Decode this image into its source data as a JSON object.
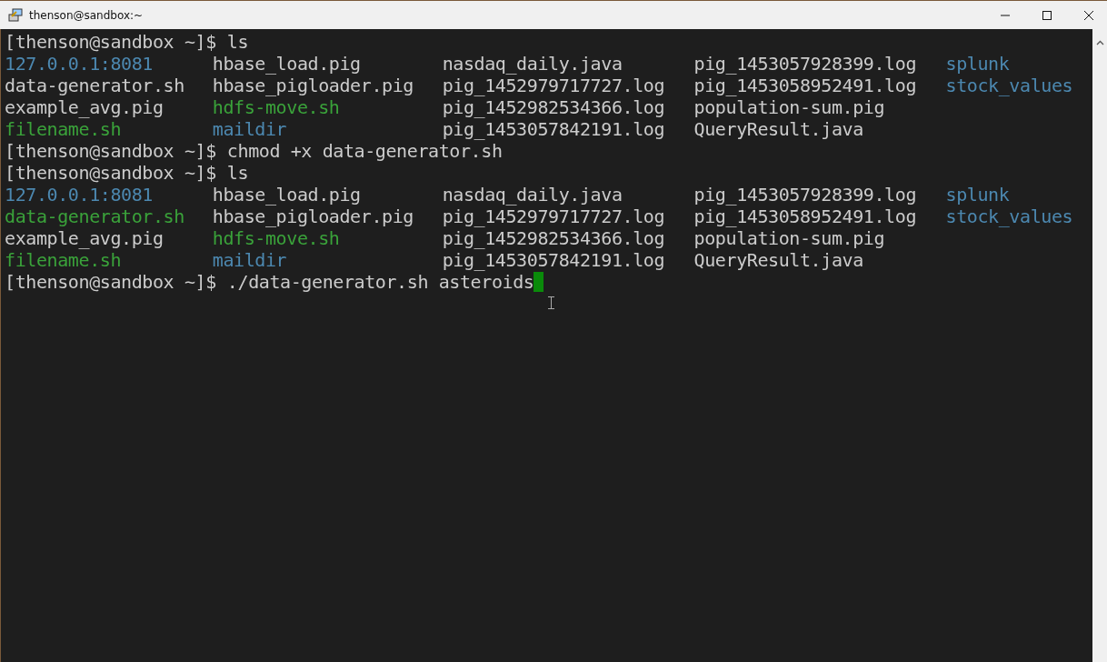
{
  "window": {
    "title": "thenson@sandbox:~"
  },
  "terminal": {
    "lines": [
      {
        "kind": "command",
        "prompt": "[thenson@sandbox ~]$",
        "command": "ls",
        "cursor": false
      },
      {
        "kind": "listing",
        "entries": [
          {
            "name": "127.0.0.1:8081",
            "kind": "dir"
          },
          {
            "name": "hbase_load.pig",
            "kind": "file"
          },
          {
            "name": "nasdaq_daily.java",
            "kind": "file"
          },
          {
            "name": "pig_1453057928399.log",
            "kind": "file"
          },
          {
            "name": "splunk",
            "kind": "dir"
          }
        ]
      },
      {
        "kind": "listing",
        "entries": [
          {
            "name": "data-generator.sh",
            "kind": "file"
          },
          {
            "name": "hbase_pigloader.pig",
            "kind": "file"
          },
          {
            "name": "pig_1452979717727.log",
            "kind": "file"
          },
          {
            "name": "pig_1453058952491.log",
            "kind": "file"
          },
          {
            "name": "stock_values",
            "kind": "dir"
          }
        ]
      },
      {
        "kind": "listing",
        "entries": [
          {
            "name": "example_avg.pig",
            "kind": "file"
          },
          {
            "name": "hdfs-move.sh",
            "kind": "exec"
          },
          {
            "name": "pig_1452982534366.log",
            "kind": "file"
          },
          {
            "name": "population-sum.pig",
            "kind": "file"
          }
        ]
      },
      {
        "kind": "listing",
        "entries": [
          {
            "name": "filename.sh",
            "kind": "exec"
          },
          {
            "name": "maildir",
            "kind": "dir"
          },
          {
            "name": "pig_1453057842191.log",
            "kind": "file"
          },
          {
            "name": "QueryResult.java",
            "kind": "file"
          }
        ]
      },
      {
        "kind": "command",
        "prompt": "[thenson@sandbox ~]$",
        "command": "chmod +x data-generator.sh",
        "cursor": false
      },
      {
        "kind": "command",
        "prompt": "[thenson@sandbox ~]$",
        "command": "ls",
        "cursor": false
      },
      {
        "kind": "listing",
        "entries": [
          {
            "name": "127.0.0.1:8081",
            "kind": "dir"
          },
          {
            "name": "hbase_load.pig",
            "kind": "file"
          },
          {
            "name": "nasdaq_daily.java",
            "kind": "file"
          },
          {
            "name": "pig_1453057928399.log",
            "kind": "file"
          },
          {
            "name": "splunk",
            "kind": "dir"
          }
        ]
      },
      {
        "kind": "listing",
        "entries": [
          {
            "name": "data-generator.sh",
            "kind": "exec"
          },
          {
            "name": "hbase_pigloader.pig",
            "kind": "file"
          },
          {
            "name": "pig_1452979717727.log",
            "kind": "file"
          },
          {
            "name": "pig_1453058952491.log",
            "kind": "file"
          },
          {
            "name": "stock_values",
            "kind": "dir"
          }
        ]
      },
      {
        "kind": "listing",
        "entries": [
          {
            "name": "example_avg.pig",
            "kind": "file"
          },
          {
            "name": "hdfs-move.sh",
            "kind": "exec"
          },
          {
            "name": "pig_1452982534366.log",
            "kind": "file"
          },
          {
            "name": "population-sum.pig",
            "kind": "file"
          }
        ]
      },
      {
        "kind": "listing",
        "entries": [
          {
            "name": "filename.sh",
            "kind": "exec"
          },
          {
            "name": "maildir",
            "kind": "dir"
          },
          {
            "name": "pig_1453057842191.log",
            "kind": "file"
          },
          {
            "name": "QueryResult.java",
            "kind": "file"
          }
        ]
      },
      {
        "kind": "command",
        "prompt": "[thenson@sandbox ~]$",
        "command": "./data-generator.sh asteroids",
        "cursor": true
      }
    ]
  }
}
